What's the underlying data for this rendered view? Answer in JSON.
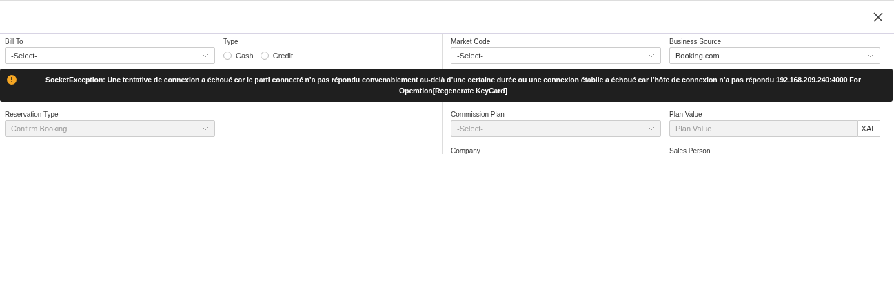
{
  "left_fields": [
    {
      "label": "Bill To",
      "kind": "select",
      "value": "-Select-",
      "disabled": false
    },
    {
      "label": "Type",
      "kind": "radio",
      "options": [
        {
          "label": "Cash",
          "selected": false
        },
        {
          "label": "Credit",
          "selected": false
        }
      ]
    },
    {
      "label": "Reservation Type",
      "kind": "select",
      "value": "Confirm Booking",
      "disabled": true
    }
  ],
  "right_fields": [
    {
      "label": "Market Code",
      "kind": "select",
      "value": "-Select-",
      "disabled": false
    },
    {
      "label": "Business Source",
      "kind": "select",
      "value": "Booking.com",
      "disabled": false
    },
    {
      "label": "Commission Plan",
      "kind": "select",
      "value": "-Select-",
      "disabled": true
    },
    {
      "label": "Plan Value",
      "kind": "addon",
      "placeholder": "Plan Value",
      "addon": "XAF",
      "disabled": true
    },
    {
      "label": "Company",
      "kind": "cut"
    },
    {
      "label": "Sales Person",
      "kind": "cut"
    }
  ],
  "toast": {
    "message": "SocketException: Une tentative de connexion a échoué car le parti connecté n’a pas répondu convenablement au-delà d’une certaine durée ou une connexion établie a échoué car l’hôte de connexion n’a pas répondu 192.168.209.240:4000 For Operation[Regenerate KeyCard]"
  }
}
